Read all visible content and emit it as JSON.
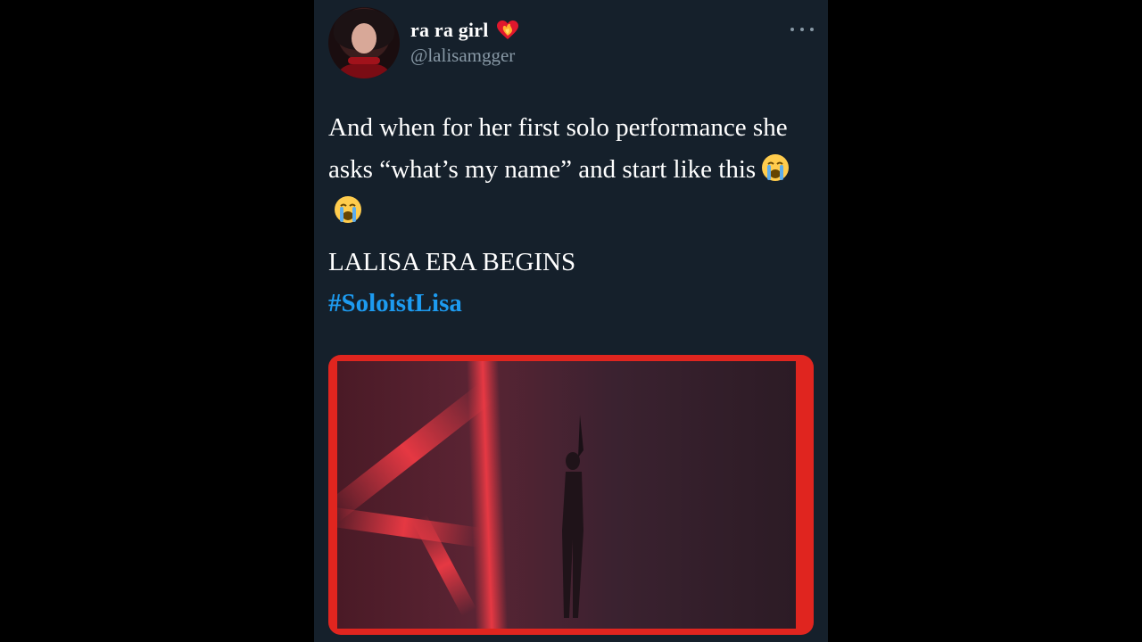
{
  "tweet": {
    "display_name": "ra ra girl",
    "handle": "@lalisamgger",
    "text": "And when for her first solo performance she asks “what’s my name” and start like this",
    "tagline": "LALISA ERA BEGINS",
    "hashtag": "#SoloistLisa",
    "emojis": [
      "crying-face-icon",
      "crying-face-icon"
    ],
    "name_badge": "heart-on-fire-icon"
  },
  "colors": {
    "background": "#000000",
    "tweet_bg": "#15202b",
    "text": "#ffffff",
    "secondary_text": "#8899a6",
    "link": "#1d9bf0",
    "media_border": "#e0251f"
  }
}
